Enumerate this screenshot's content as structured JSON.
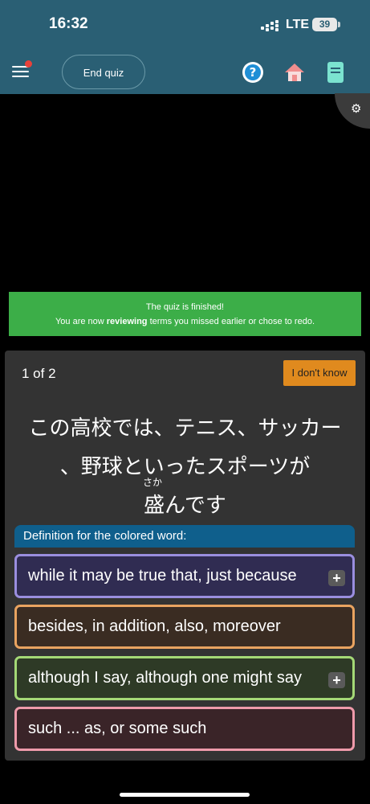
{
  "status": {
    "time": "16:32",
    "network": "LTE",
    "battery": "39"
  },
  "header": {
    "end_quiz": "End quiz"
  },
  "banner": {
    "line1": "The quiz is finished!",
    "line2_prefix": "You are now ",
    "line2_bold": "reviewing",
    "line2_suffix": " terms you missed earlier or chose to redo."
  },
  "card": {
    "counter": "1 of 2",
    "dont_know": "I don't know",
    "sentence_line1": "この高校では、テニス、サッカー",
    "sentence_line2": "、野球といったスポーツが",
    "sentence_line3": "盛んです",
    "furigana": "さか",
    "definition_label": "Definition for the colored word:",
    "options": [
      {
        "text": "while it may be true that, just because",
        "border": "#9a8ede",
        "bg": "#302c52",
        "more": true
      },
      {
        "text": "besides, in addition, also, moreover",
        "border": "#e8a360",
        "bg": "#3a2c22",
        "more": false
      },
      {
        "text": "although I say, although one might say",
        "border": "#a4d876",
        "bg": "#2e3a26",
        "more": true
      },
      {
        "text": "such ... as, or some such",
        "border": "#ee9aaa",
        "bg": "#3a2428",
        "more": false
      }
    ]
  },
  "icons": [
    "menu-icon",
    "help-icon",
    "home-icon",
    "book-icon",
    "gear-icon"
  ]
}
